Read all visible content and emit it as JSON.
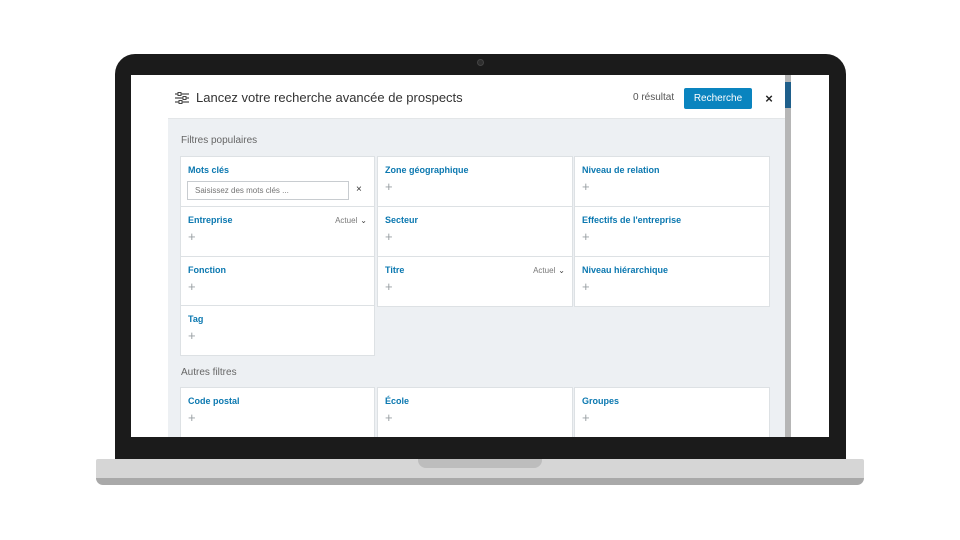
{
  "modal": {
    "title": "Lancez votre recherche avancée de prospects",
    "results": "0 résultat",
    "search_button": "Recherche",
    "close": "×"
  },
  "popular": {
    "title": "Filtres populaires",
    "keywords": {
      "label": "Mots clés",
      "placeholder": "Saisissez des mots clés ...",
      "clear": "×"
    },
    "filters": [
      {
        "label": "Zone géographique",
        "add": "+"
      },
      {
        "label": "Niveau de relation",
        "add": "+"
      },
      {
        "label": "Entreprise",
        "add": "+",
        "select": "Actuel",
        "chevron": "⌄"
      },
      {
        "label": "Secteur",
        "add": "+"
      },
      {
        "label": "Effectifs de l'entreprise",
        "add": "+"
      },
      {
        "label": "Fonction",
        "add": "+"
      },
      {
        "label": "Titre",
        "add": "+",
        "select": "Actuel",
        "chevron": "⌄"
      },
      {
        "label": "Niveau hiérarchique",
        "add": "+"
      },
      {
        "label": "Tag",
        "add": "+"
      }
    ]
  },
  "other": {
    "title": "Autres filtres",
    "filters": [
      {
        "label": "Code postal",
        "add": "+"
      },
      {
        "label": "École",
        "add": "+"
      },
      {
        "label": "Groupes",
        "add": "+"
      }
    ]
  },
  "colors": {
    "accent": "#0a84bf",
    "label": "#0b78b0",
    "panel": "#edf0f3",
    "bezel": "#1b1b1b"
  },
  "icons": {
    "filter": "sliders-icon"
  }
}
